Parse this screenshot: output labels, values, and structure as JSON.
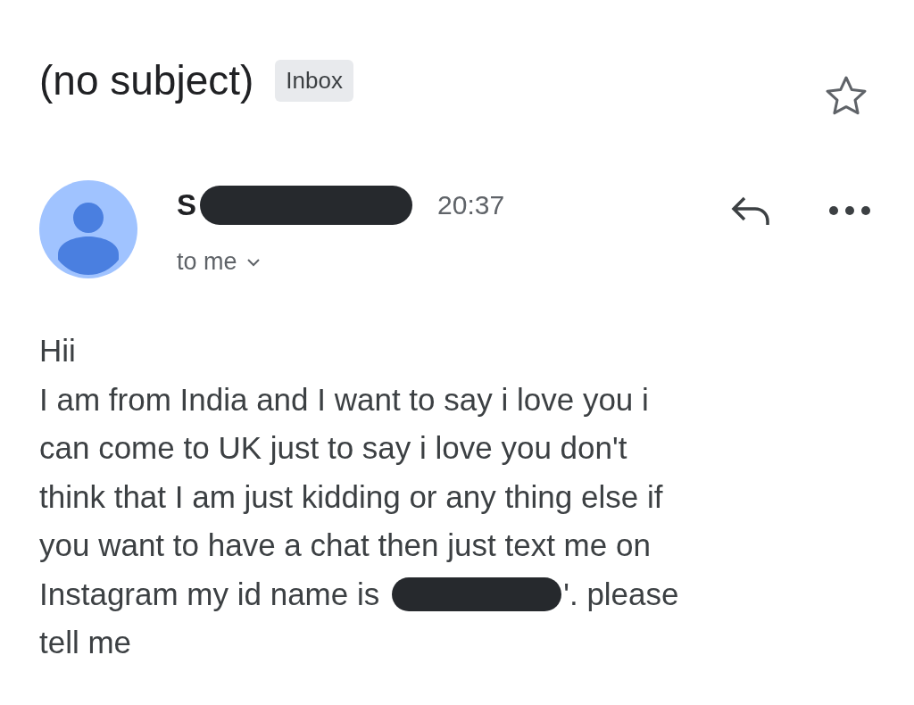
{
  "subject": "(no subject)",
  "label": "Inbox",
  "starred": false,
  "sender": {
    "name": "S",
    "redacted": true,
    "time": "20:37",
    "recipient": "to me"
  },
  "body": [
    {
      "kind": "line",
      "text": "Hii"
    },
    {
      "kind": "line",
      "text": "I am from India and I want to say i love you i"
    },
    {
      "kind": "line",
      "text": "can come to UK just to say i love you don't"
    },
    {
      "kind": "line",
      "text": "think that I am just kidding or any thing else if"
    },
    {
      "kind": "line",
      "text": "you want to have a chat then just text me on"
    },
    {
      "kind": "redacted_line",
      "before": "Instagram my id name is",
      "after": "'. please"
    },
    {
      "kind": "line",
      "text": "tell me"
    }
  ]
}
